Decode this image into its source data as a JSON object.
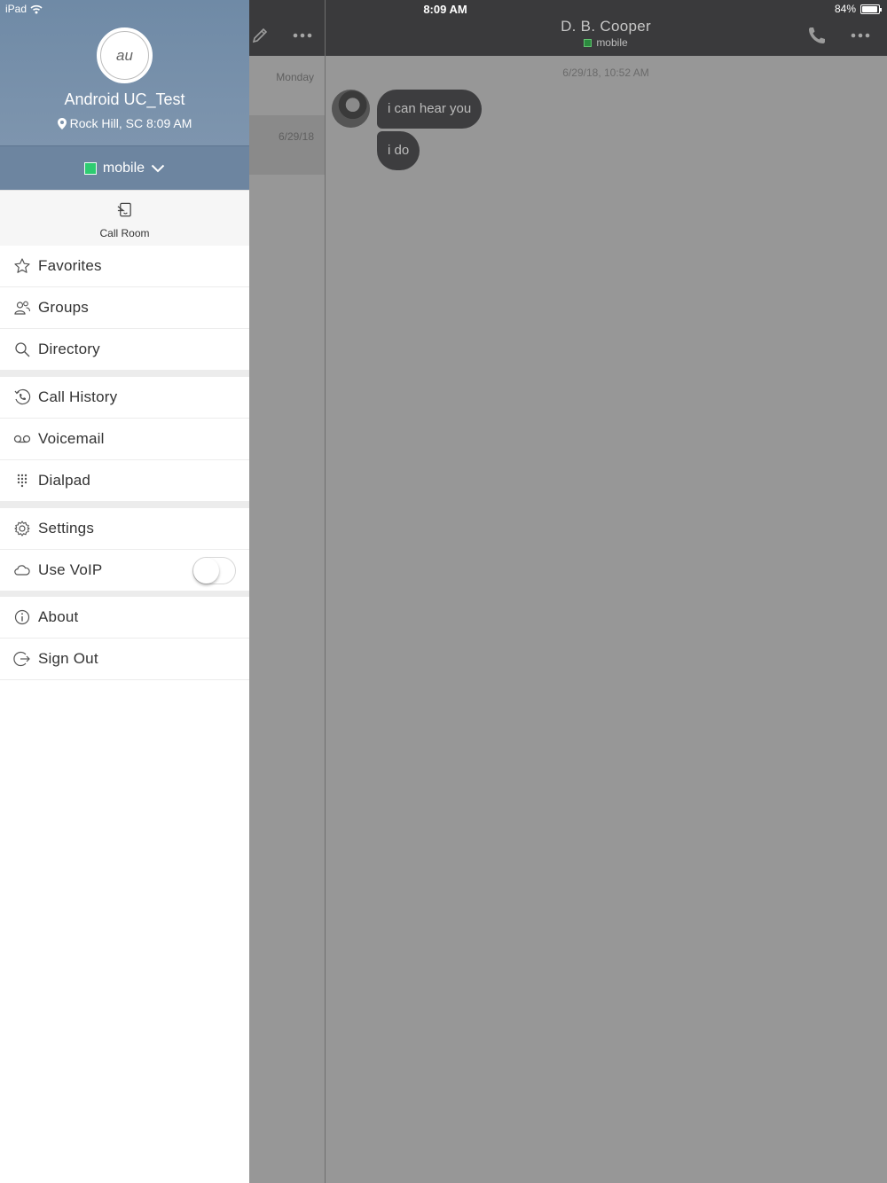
{
  "status_bar": {
    "device": "iPad",
    "time": "8:09 AM",
    "battery": "84%",
    "battery_level": 0.84
  },
  "profile": {
    "initials": "au",
    "name": "Android UC_Test",
    "location": "Rock Hill, SC 8:09 AM",
    "presence": "mobile",
    "presence_color": "#2ecc71"
  },
  "call_room": {
    "label": "Call Room"
  },
  "menu": {
    "favorites": "Favorites",
    "groups": "Groups",
    "directory": "Directory",
    "call_history": "Call History",
    "voicemail": "Voicemail",
    "dialpad": "Dialpad",
    "settings": "Settings",
    "use_voip": "Use VoIP",
    "use_voip_on": false,
    "about": "About",
    "sign_out": "Sign Out"
  },
  "conversation_list": {
    "items": [
      {
        "date": "Monday"
      },
      {
        "date": "6/29/18"
      }
    ]
  },
  "chat_header": {
    "name": "D. B. Cooper",
    "status": "mobile"
  },
  "chat": {
    "date": "6/29/18, 10:52 AM",
    "messages": [
      {
        "text": "i can hear you"
      },
      {
        "text": "i do"
      }
    ]
  }
}
